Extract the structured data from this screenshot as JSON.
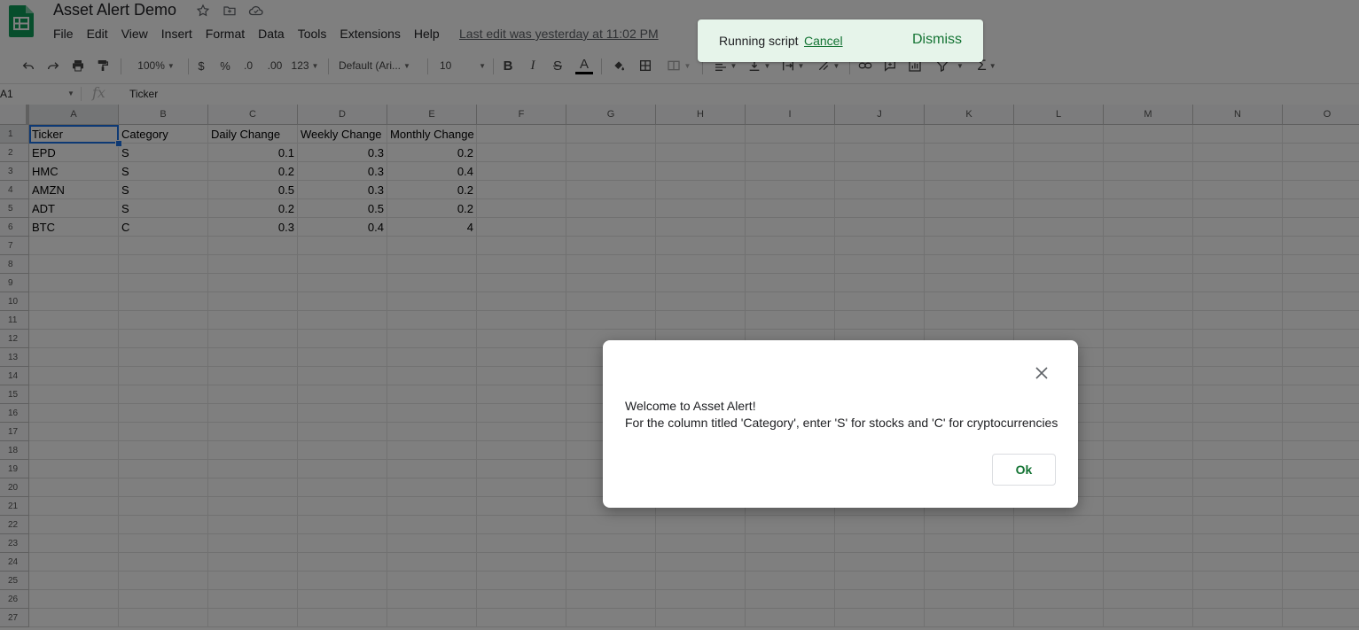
{
  "doc": {
    "title": "Asset Alert Demo",
    "last_edit": "Last edit was yesterday at 11:02 PM"
  },
  "menu": [
    "File",
    "Edit",
    "View",
    "Insert",
    "Format",
    "Data",
    "Tools",
    "Extensions",
    "Help"
  ],
  "toolbar": {
    "zoom": "100%",
    "currency": "$",
    "percent": "%",
    "decrease_decimal": ".0",
    "increase_decimal": ".00",
    "more_formats": "123",
    "font": "Default (Ari...",
    "font_size": "10",
    "bold": "B",
    "italic": "I",
    "strike": "S",
    "text_color": "A"
  },
  "formula": {
    "cell_ref": "A1",
    "fx": "fx",
    "content": "Ticker"
  },
  "grid": {
    "columns": [
      "A",
      "B",
      "C",
      "D",
      "E",
      "F",
      "G",
      "H",
      "I",
      "J",
      "K",
      "L",
      "M",
      "N",
      "O"
    ],
    "rows": [
      "1",
      "2",
      "3",
      "4",
      "5",
      "6",
      "7",
      "8",
      "9",
      "10",
      "11",
      "12",
      "13",
      "14",
      "15",
      "16",
      "17",
      "18",
      "19",
      "20",
      "21",
      "22",
      "23",
      "24",
      "25",
      "26",
      "27"
    ],
    "data": [
      [
        "Ticker",
        "Category",
        "Daily Change",
        "Weekly Change",
        "Monthly Change"
      ],
      [
        "EPD",
        "S",
        "0.1",
        "0.3",
        "0.2"
      ],
      [
        "HMC",
        "S",
        "0.2",
        "0.3",
        "0.4"
      ],
      [
        "AMZN",
        "S",
        "0.5",
        "0.3",
        "0.2"
      ],
      [
        "ADT",
        "S",
        "0.2",
        "0.5",
        "0.2"
      ],
      [
        "BTC",
        "C",
        "0.3",
        "0.4",
        "4"
      ]
    ]
  },
  "toast": {
    "message": "Running script",
    "cancel": "Cancel",
    "dismiss": "Dismiss"
  },
  "dialog": {
    "line1": "Welcome to Asset Alert!",
    "line2": "For the column titled 'Category', enter 'S' for stocks and 'C' for cryptocurrencies",
    "ok": "Ok"
  },
  "colors": {
    "accent_green": "#137333",
    "toast_bg": "#e6f4ea",
    "selection": "#1a73e8",
    "sheets_logo": "#0f9d58"
  }
}
